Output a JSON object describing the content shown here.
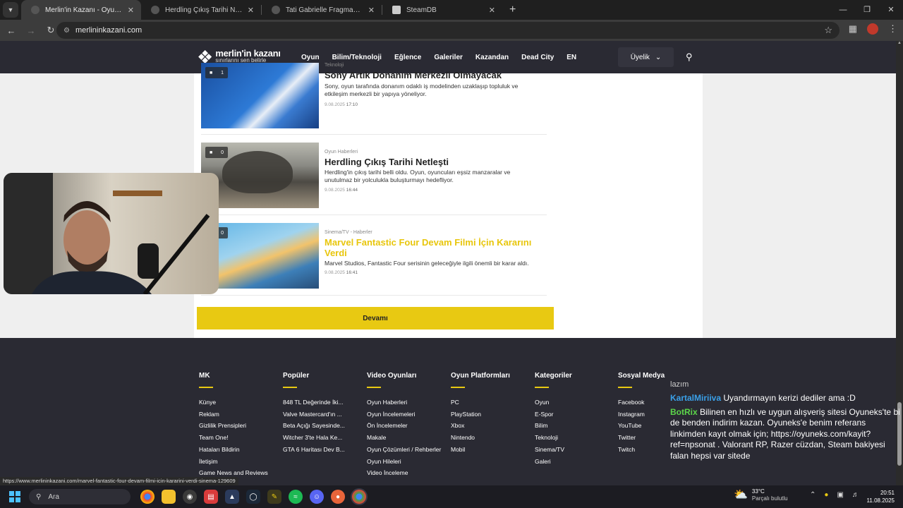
{
  "browser": {
    "tabs": [
      {
        "title": "Merlin'in Kazanı - Oyun İncelem",
        "active": true
      },
      {
        "title": "Herdling Çıkış Tarihi Netleşti",
        "active": false
      },
      {
        "title": "Tati Gabrielle Fragman Tepkiler",
        "active": false
      },
      {
        "title": "SteamDB",
        "active": false
      }
    ],
    "url": "merlininkazani.com",
    "status_url": "https://www.merlininkazani.com/marvel-fantastic-four-devam-filmi-icin-kararini-verdi-sinema-129609"
  },
  "site": {
    "logo_title": "merlin'in kazanı",
    "logo_tagline": "sınırlarını sen belirle",
    "nav": [
      "Oyun",
      "Bilim/Teknoloji",
      "Eğlence",
      "Galeriler",
      "Kazandan",
      "Dead City",
      "EN"
    ],
    "account_label": "Üyelik"
  },
  "articles": [
    {
      "category": "Teknoloji",
      "title": "Sony Artık Donanım Merkezli Olmayacak",
      "desc": "Sony, oyun tarafında donanım odaklı iş modelinden uzaklaşıp topluluk ve etkileşim merkezli bir yapıya yöneliyor.",
      "date": "9.08.2025",
      "time": "17:10",
      "comments": "1"
    },
    {
      "category": "Oyun Haberleri",
      "title": "Herdling Çıkış Tarihi Netleşti",
      "desc": "Herdling'in çıkış tarihi belli oldu. Oyun, oyuncuları eşsiz manzaralar ve unutulmaz bir yolculukla buluşturmayı hedefliyor.",
      "date": "9.08.2025",
      "time": "16:44",
      "comments": "0"
    },
    {
      "category": "Sinema/TV - Haberler",
      "title": "Marvel Fantastic Four Devam Filmi İçin Kararını Verdi",
      "desc": "Marvel Studios, Fantastic Four serisinin geleceğiyle ilgili önemli bir karar aldı.",
      "date": "9.08.2025",
      "time": "16:41",
      "comments": "0"
    }
  ],
  "more_label": "Devamı",
  "footer": {
    "columns": [
      {
        "heading": "MK",
        "items": [
          "Künye",
          "Reklam",
          "Gizlilik Prensipleri",
          "Team One!",
          "Hataları Bildirin",
          "İletişim",
          "Game News and Reviews"
        ]
      },
      {
        "heading": "Popüler",
        "items": [
          "848 TL Değerinde İki...",
          "Valve Mastercard'ın ...",
          "Beta Açığı Sayesinde...",
          "Witcher 3'te Hala Ke...",
          "GTA 6 Haritası Dev B..."
        ]
      },
      {
        "heading": "Video Oyunları",
        "items": [
          "Oyun Haberleri",
          "Oyun İncelemeleri",
          "Ön İncelemeler",
          "Makale",
          "Oyun Çözümleri / Rehberler",
          "Oyun Hileleri",
          "Video İnceleme"
        ]
      },
      {
        "heading": "Oyun Platformları",
        "items": [
          "PC",
          "PlayStation",
          "Xbox",
          "Nintendo",
          "Mobil"
        ]
      },
      {
        "heading": "Kategoriler",
        "items": [
          "Oyun",
          "E-Spor",
          "Bilim",
          "Teknoloji",
          "Sinema/TV",
          "Galeri"
        ]
      },
      {
        "heading": "Sosyal Medya",
        "items": [
          "Facebook",
          "Instagram",
          "YouTube",
          "Twitter",
          "Twitch"
        ]
      }
    ]
  },
  "chat": {
    "faded": "lazım",
    "messages": [
      {
        "user": "KartalMiriiva",
        "text": "Uyandırmayın kerizi dediler ama :D"
      },
      {
        "user": "BotRix",
        "text": "Bilinen en hızlı ve uygun alışveriş sitesi Oyuneks'te bi de benden indirim kazan. Oyuneks'e benim referans linkimden kayıt olmak için; https://oyuneks.com/kayit?ref=npsonat . Valorant RP, Razer cüzdan, Steam bakiyesi falan hepsi var sitede"
      }
    ]
  },
  "taskbar": {
    "search_placeholder": "Ara",
    "weather_temp": "33°C",
    "weather_desc": "Parçalı bulutlu",
    "time": "20:51",
    "date": "11.08.2025"
  },
  "colors": {
    "accent": "#e8c912",
    "header_bg": "#2a2a33",
    "chat_user1": "#3aa0e8",
    "chat_user2": "#5cd64a"
  }
}
